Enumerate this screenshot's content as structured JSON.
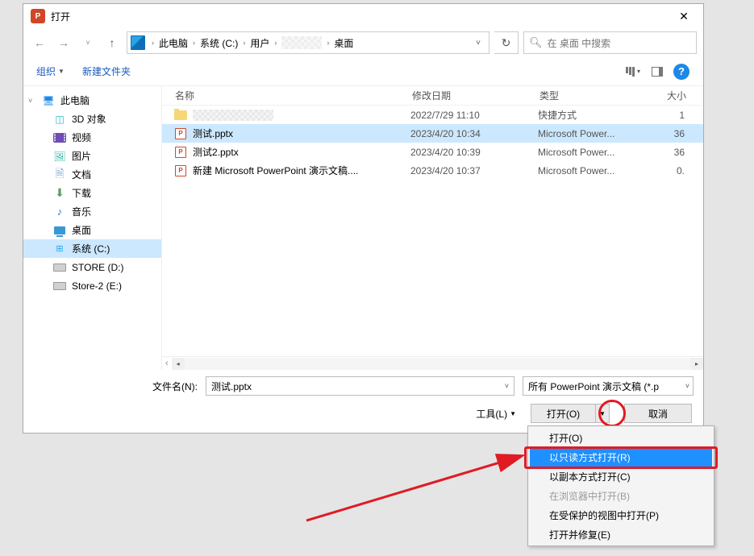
{
  "title": "打开",
  "breadcrumb": [
    "此电脑",
    "系统 (C:)",
    "用户",
    "",
    "桌面"
  ],
  "search_placeholder": "在 桌面 中搜索",
  "toolbar": {
    "organize": "组织",
    "new_folder": "新建文件夹"
  },
  "columns": {
    "name": "名称",
    "date": "修改日期",
    "type": "类型",
    "size": "大小"
  },
  "sidebar": [
    {
      "label": "此电脑",
      "icon": "pc",
      "indent": 0
    },
    {
      "label": "3D 对象",
      "icon": "3d",
      "indent": 1
    },
    {
      "label": "视频",
      "icon": "video",
      "indent": 1
    },
    {
      "label": "图片",
      "icon": "img",
      "indent": 1
    },
    {
      "label": "文档",
      "icon": "doc",
      "indent": 1
    },
    {
      "label": "下载",
      "icon": "dl",
      "indent": 1
    },
    {
      "label": "音乐",
      "icon": "music",
      "indent": 1
    },
    {
      "label": "桌面",
      "icon": "desk",
      "indent": 1
    },
    {
      "label": "系统 (C:)",
      "icon": "win",
      "indent": 1,
      "selected": true
    },
    {
      "label": "STORE (D:)",
      "icon": "drive",
      "indent": 1
    },
    {
      "label": "Store-2 (E:)",
      "icon": "drive",
      "indent": 1
    }
  ],
  "files": [
    {
      "name": "",
      "pixelated": true,
      "icon": "folder",
      "date": "2022/7/29 11:10",
      "type": "快捷方式",
      "size": "1"
    },
    {
      "name": "测试.pptx",
      "icon": "ppt",
      "date": "2023/4/20 10:34",
      "type": "Microsoft Power...",
      "size": "36",
      "selected": true
    },
    {
      "name": "测试2.pptx",
      "icon": "ppt",
      "date": "2023/4/20 10:39",
      "type": "Microsoft Power...",
      "size": "36"
    },
    {
      "name": "新建 Microsoft PowerPoint 演示文稿....",
      "icon": "ppt",
      "date": "2023/4/20 10:37",
      "type": "Microsoft Power...",
      "size": "0."
    }
  ],
  "filename_label": "文件名(N):",
  "filename_value": "测试.pptx",
  "type_filter": "所有 PowerPoint 演示文稿 (*.p",
  "tools_label": "工具(L)",
  "open_label": "打开(O)",
  "cancel_label": "取消",
  "dropdown": [
    {
      "label": "打开(O)"
    },
    {
      "label": "以只读方式打开(R)",
      "highlighted": true
    },
    {
      "label": "以副本方式打开(C)"
    },
    {
      "label": "在浏览器中打开(B)",
      "disabled": true
    },
    {
      "label": "在受保护的视图中打开(P)"
    },
    {
      "label": "打开并修复(E)"
    }
  ]
}
